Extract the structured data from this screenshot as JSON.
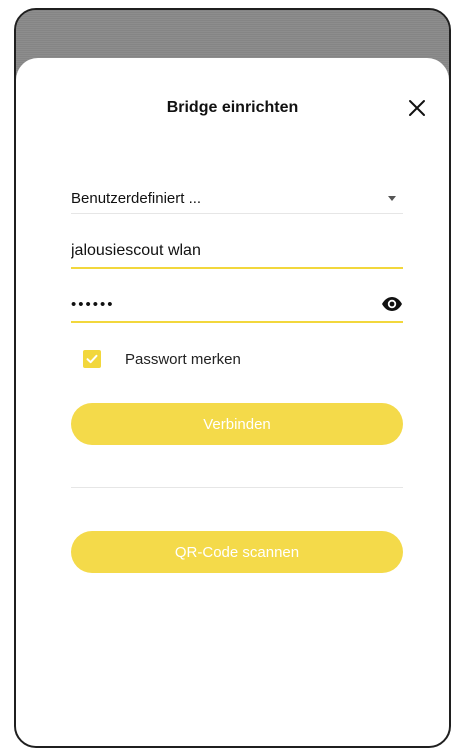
{
  "dialog": {
    "title": "Bridge einrichten"
  },
  "form": {
    "network_select": {
      "value": "Benutzerdefiniert ..."
    },
    "ssid": {
      "value": "jalousiescout wlan"
    },
    "password": {
      "value": "••••••"
    },
    "remember_password": {
      "label": "Passwort merken",
      "checked": true
    },
    "connect_label": "Verbinden",
    "qr_label": "QR-Code scannen"
  },
  "colors": {
    "accent": "#f4da4a",
    "underline": "#f2d73c",
    "backdrop": "#8a8a8a"
  },
  "icons": {
    "close": "close-icon",
    "caret": "chevron-down-icon",
    "eye": "eye-icon",
    "check": "check-icon"
  }
}
